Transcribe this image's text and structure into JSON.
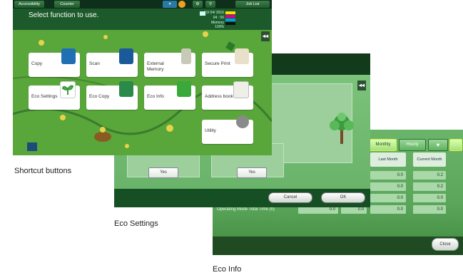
{
  "captions": {
    "shortcut": "Shortcut buttons",
    "eco_settings": "Eco Settings",
    "eco_info": "Eco Info"
  },
  "shortcut_panel": {
    "topbar": {
      "accessibility": "Accessibility",
      "counter": "Counter",
      "job_list": "Job List"
    },
    "title": "Select function to use.",
    "status": {
      "date": "10/ 04/ 2016",
      "time": "04 : 06",
      "memory_label": "Memory",
      "memory_value": "100%"
    },
    "buttons": [
      {
        "label": "Copy",
        "icon": "copy-icon"
      },
      {
        "label": "Scan",
        "icon": "scan-icon"
      },
      {
        "label": "External Memory",
        "icon": "external-memory-icon"
      },
      {
        "label": "Secure Print",
        "icon": "secure-print-icon"
      },
      {
        "label": "Eco Settings",
        "icon": "eco-settings-icon"
      },
      {
        "label": "Eco Copy",
        "icon": "eco-copy-icon"
      },
      {
        "label": "Eco Info",
        "icon": "eco-info-icon"
      },
      {
        "label": "Address book",
        "icon": "address-book-icon"
      },
      {
        "label": "Utility",
        "icon": "utility-icon"
      }
    ],
    "colors": {
      "accent": "#59a63a",
      "header": "#1d5a2b"
    }
  },
  "eco_settings_panel": {
    "yes_left": "Yes",
    "yes_right": "Yes",
    "cancel": "Cancel",
    "ok": "OK",
    "collapse": "◂◂"
  },
  "eco_info_panel": {
    "tabs": {
      "monthly": "Monthly",
      "hourly": "Hourly"
    },
    "columns": {
      "last_month": "Last Month",
      "current_month": "Current Month"
    },
    "row_label": "Operating Mode Total Time (h)",
    "values": [
      {
        "last_month": "0.0",
        "current_month": "0.2"
      },
      {
        "last_month": "0.0",
        "current_month": "0.2"
      },
      {
        "last_month": "0.0",
        "current_month": "0.0"
      },
      {
        "last_month": "0.0",
        "current_month": "0.0"
      }
    ],
    "left_values": [
      "0.0",
      "0.0"
    ],
    "close": "Close"
  }
}
